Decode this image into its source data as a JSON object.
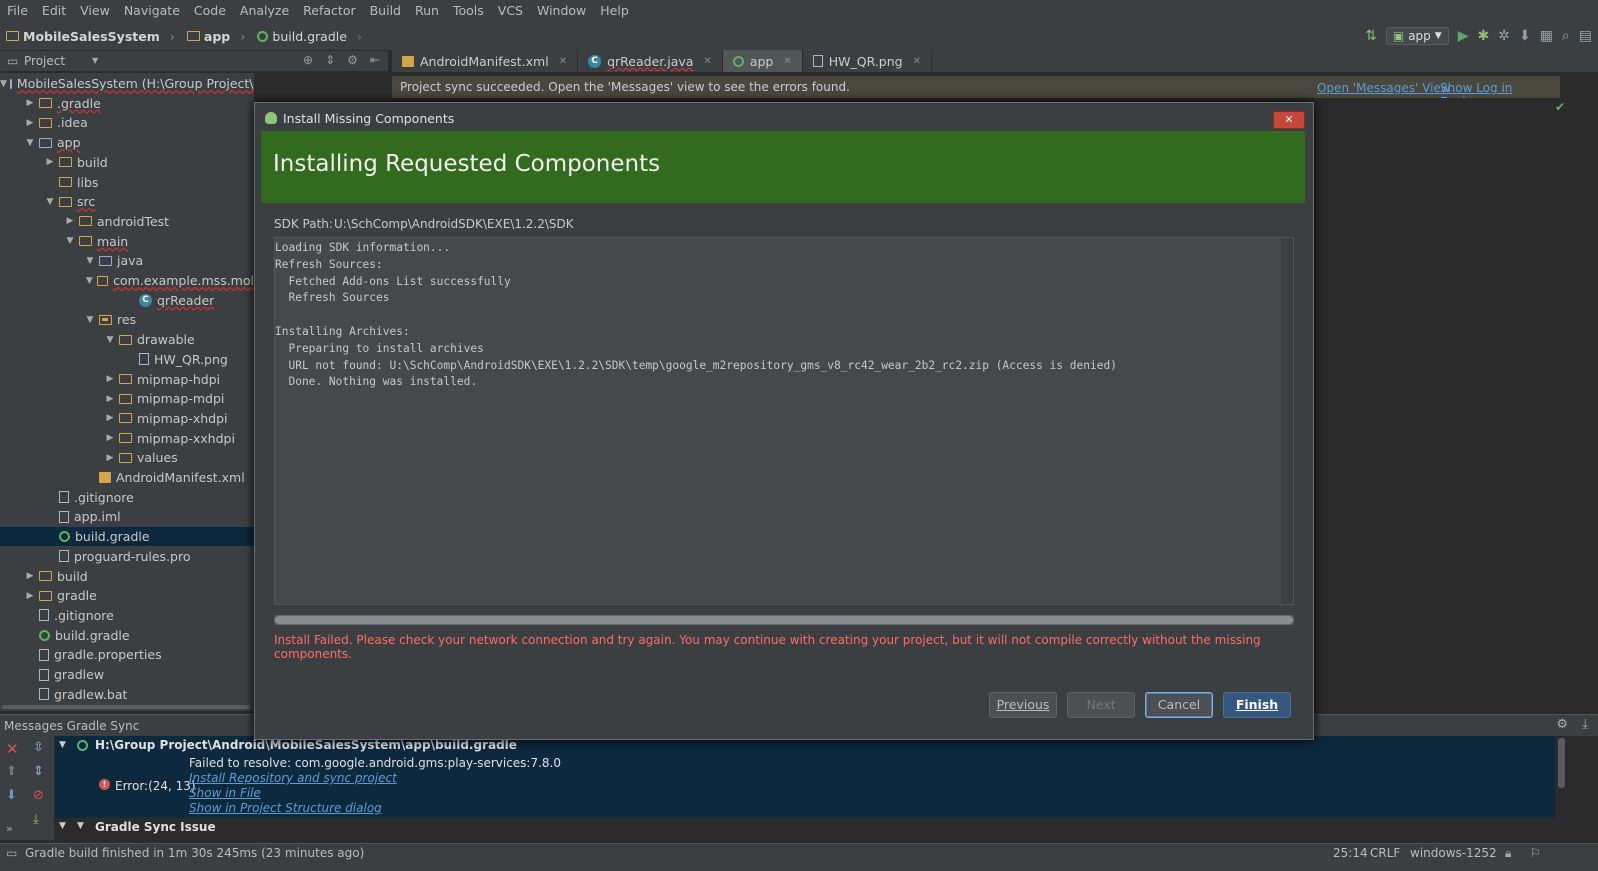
{
  "menu": [
    "File",
    "Edit",
    "View",
    "Navigate",
    "Code",
    "Analyze",
    "Refactor",
    "Build",
    "Run",
    "Tools",
    "VCS",
    "Window",
    "Help"
  ],
  "breadcrumb": {
    "project": "MobileSalesSystem",
    "module": "app",
    "file": "build.gradle"
  },
  "toolbar": {
    "run_config": "app"
  },
  "project_panel": {
    "title": "Project"
  },
  "tabs": [
    {
      "label": "AndroidManifest.xml",
      "icon": "xml-file-icon"
    },
    {
      "label": "qrReader.java",
      "icon": "java-class-icon"
    },
    {
      "label": "app",
      "icon": "gradle-icon"
    },
    {
      "label": "HW_QR.png",
      "icon": "image-file-icon"
    }
  ],
  "notification": {
    "message": "Project sync succeeded. Open the 'Messages' view to see the errors found.",
    "link1": "Open 'Messages' View",
    "link2": "Show Log in Explorer"
  },
  "tree": [
    {
      "label": "MobileSalesSystem (H:\\Group Project\\Android\\MobileSalesSyste",
      "depth": 0,
      "arrow": "open",
      "icon": "module"
    },
    {
      "label": ".gradle",
      "depth": 1,
      "arrow": "closed",
      "icon": "folder"
    },
    {
      "label": ".idea",
      "depth": 1,
      "arrow": "closed",
      "icon": "folder"
    },
    {
      "label": "app",
      "depth": 1,
      "arrow": "open",
      "icon": "module"
    },
    {
      "label": "build",
      "depth": 2,
      "arrow": "closed",
      "icon": "folder"
    },
    {
      "label": "libs",
      "depth": 2,
      "arrow": "none",
      "icon": "folder"
    },
    {
      "label": "src",
      "depth": 2,
      "arrow": "open",
      "icon": "folder"
    },
    {
      "label": "androidTest",
      "depth": 3,
      "arrow": "closed",
      "icon": "folder"
    },
    {
      "label": "main",
      "depth": 3,
      "arrow": "open",
      "icon": "folder"
    },
    {
      "label": "java",
      "depth": 4,
      "arrow": "open",
      "icon": "src"
    },
    {
      "label": "com.example.mss.mol",
      "depth": 5,
      "arrow": "open",
      "icon": "folder"
    },
    {
      "label": "qrReader",
      "depth": 6,
      "arrow": "none",
      "icon": "class"
    },
    {
      "label": "res",
      "depth": 4,
      "arrow": "open",
      "icon": "res"
    },
    {
      "label": "drawable",
      "depth": 5,
      "arrow": "open",
      "icon": "folder"
    },
    {
      "label": "HW_QR.png",
      "depth": 6,
      "arrow": "none",
      "icon": "file"
    },
    {
      "label": "mipmap-hdpi",
      "depth": 5,
      "arrow": "closed",
      "icon": "folder"
    },
    {
      "label": "mipmap-mdpi",
      "depth": 5,
      "arrow": "closed",
      "icon": "folder"
    },
    {
      "label": "mipmap-xhdpi",
      "depth": 5,
      "arrow": "closed",
      "icon": "folder"
    },
    {
      "label": "mipmap-xxhdpi",
      "depth": 5,
      "arrow": "closed",
      "icon": "folder"
    },
    {
      "label": "values",
      "depth": 5,
      "arrow": "closed",
      "icon": "folder"
    },
    {
      "label": "AndroidManifest.xml",
      "depth": 4,
      "arrow": "none",
      "icon": "xml"
    },
    {
      "label": ".gitignore",
      "depth": 2,
      "arrow": "none",
      "icon": "file"
    },
    {
      "label": "app.iml",
      "depth": 2,
      "arrow": "none",
      "icon": "file"
    },
    {
      "label": "build.gradle",
      "depth": 2,
      "arrow": "none",
      "icon": "gradle",
      "selected": true
    },
    {
      "label": "proguard-rules.pro",
      "depth": 2,
      "arrow": "none",
      "icon": "file"
    },
    {
      "label": "build",
      "depth": 1,
      "arrow": "closed",
      "icon": "folder"
    },
    {
      "label": "gradle",
      "depth": 1,
      "arrow": "closed",
      "icon": "folder"
    },
    {
      "label": ".gitignore",
      "depth": 1,
      "arrow": "none",
      "icon": "file"
    },
    {
      "label": "build.gradle",
      "depth": 1,
      "arrow": "none",
      "icon": "gradle"
    },
    {
      "label": "gradle.properties",
      "depth": 1,
      "arrow": "none",
      "icon": "file"
    },
    {
      "label": "gradlew",
      "depth": 1,
      "arrow": "none",
      "icon": "file"
    },
    {
      "label": "gradlew.bat",
      "depth": 1,
      "arrow": "none",
      "icon": "file"
    }
  ],
  "messages": {
    "title": "Messages Gradle Sync",
    "path": "H:\\Group Project\\Android\\MobileSalesSystem\\app\\build.gradle",
    "error_loc": "Error:(24, 13)",
    "error_msg": "Failed to resolve: com.google.android.gms:play-services:7.8.0",
    "link_install": "Install Repository and sync project",
    "link_show_file": "Show in File",
    "link_show_struct": "Show in Project Structure dialog",
    "next_group": "Gradle Sync Issue"
  },
  "status": {
    "left": "Gradle build finished in 1m 30s 245ms (23 minutes ago)",
    "pos": "25:14",
    "line_sep": "CRLF",
    "encoding": "windows-1252"
  },
  "dialog": {
    "title": "Install Missing Components",
    "heading": "Installing Requested Components",
    "sdk_label": "SDK Path:",
    "sdk_path": "U:\\SchComp\\AndroidSDK\\EXE\\1.2.2\\SDK",
    "log_lines": [
      "Loading SDK information...",
      "Refresh Sources:",
      "  Fetched Add-ons List successfully",
      "  Refresh Sources",
      "",
      "Installing Archives:",
      "  Preparing to install archives",
      "  URL not found: U:\\SchComp\\AndroidSDK\\EXE\\1.2.2\\SDK\\temp\\google_m2repository_gms_v8_rc42_wear_2b2_rc2.zip (Access is denied)",
      "  Done. Nothing was installed."
    ],
    "progress": 1.0,
    "error": "Install Failed. Please check your network connection and try again. You may continue with creating your project, but it will not compile correctly without the missing components.",
    "buttons": {
      "previous": "Previous",
      "next": "Next",
      "cancel": "Cancel",
      "finish": "Finish"
    }
  },
  "colors": {
    "accent_green": "#336b1e",
    "error_red": "#ff6b68",
    "link_blue": "#5b9cd8",
    "selection": "#0d293e"
  }
}
